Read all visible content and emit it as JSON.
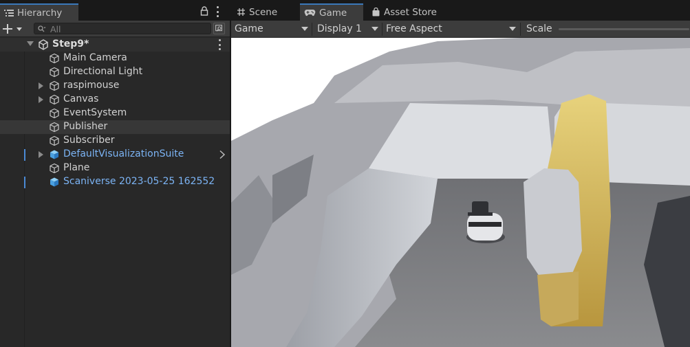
{
  "hierarchy": {
    "tab_label": "Hierarchy",
    "search_placeholder": "All",
    "scene": {
      "name": "Step9*"
    },
    "items": [
      {
        "label": "Main Camera",
        "type": "gameobject",
        "expandable": false,
        "selected": false,
        "prefab": false
      },
      {
        "label": "Directional Light",
        "type": "gameobject",
        "expandable": false,
        "selected": false,
        "prefab": false
      },
      {
        "label": "raspimouse",
        "type": "gameobject",
        "expandable": true,
        "selected": false,
        "prefab": false
      },
      {
        "label": "Canvas",
        "type": "gameobject",
        "expandable": true,
        "selected": false,
        "prefab": false
      },
      {
        "label": "EventSystem",
        "type": "gameobject",
        "expandable": false,
        "selected": false,
        "prefab": false
      },
      {
        "label": "Publisher",
        "type": "gameobject",
        "expandable": false,
        "selected": true,
        "prefab": false
      },
      {
        "label": "Subscriber",
        "type": "gameobject",
        "expandable": false,
        "selected": false,
        "prefab": false
      },
      {
        "label": "DefaultVisualizationSuite",
        "type": "prefab",
        "expandable": true,
        "selected": false,
        "prefab": true
      },
      {
        "label": "Plane",
        "type": "gameobject",
        "expandable": false,
        "selected": false,
        "prefab": false
      },
      {
        "label": "Scaniverse 2023-05-25 162552",
        "type": "prefab",
        "expandable": false,
        "selected": false,
        "prefab": true
      }
    ]
  },
  "tabs": [
    {
      "label": "Scene",
      "icon": "grid-icon",
      "active": false
    },
    {
      "label": "Game",
      "icon": "gamepad-icon",
      "active": true
    },
    {
      "label": "Asset Store",
      "icon": "shopping-bag-icon",
      "active": false
    }
  ],
  "game_toolbar": {
    "view_mode": "Game",
    "display": "Display 1",
    "aspect": "Free Aspect",
    "scale_label": "Scale"
  },
  "colors": {
    "panel_bg": "#282828",
    "toolbar_bg": "#3c3c3c",
    "active_tab_accent": "#3a79bb",
    "prefab_text": "#7cb4f5",
    "text": "#d2d2d2"
  }
}
